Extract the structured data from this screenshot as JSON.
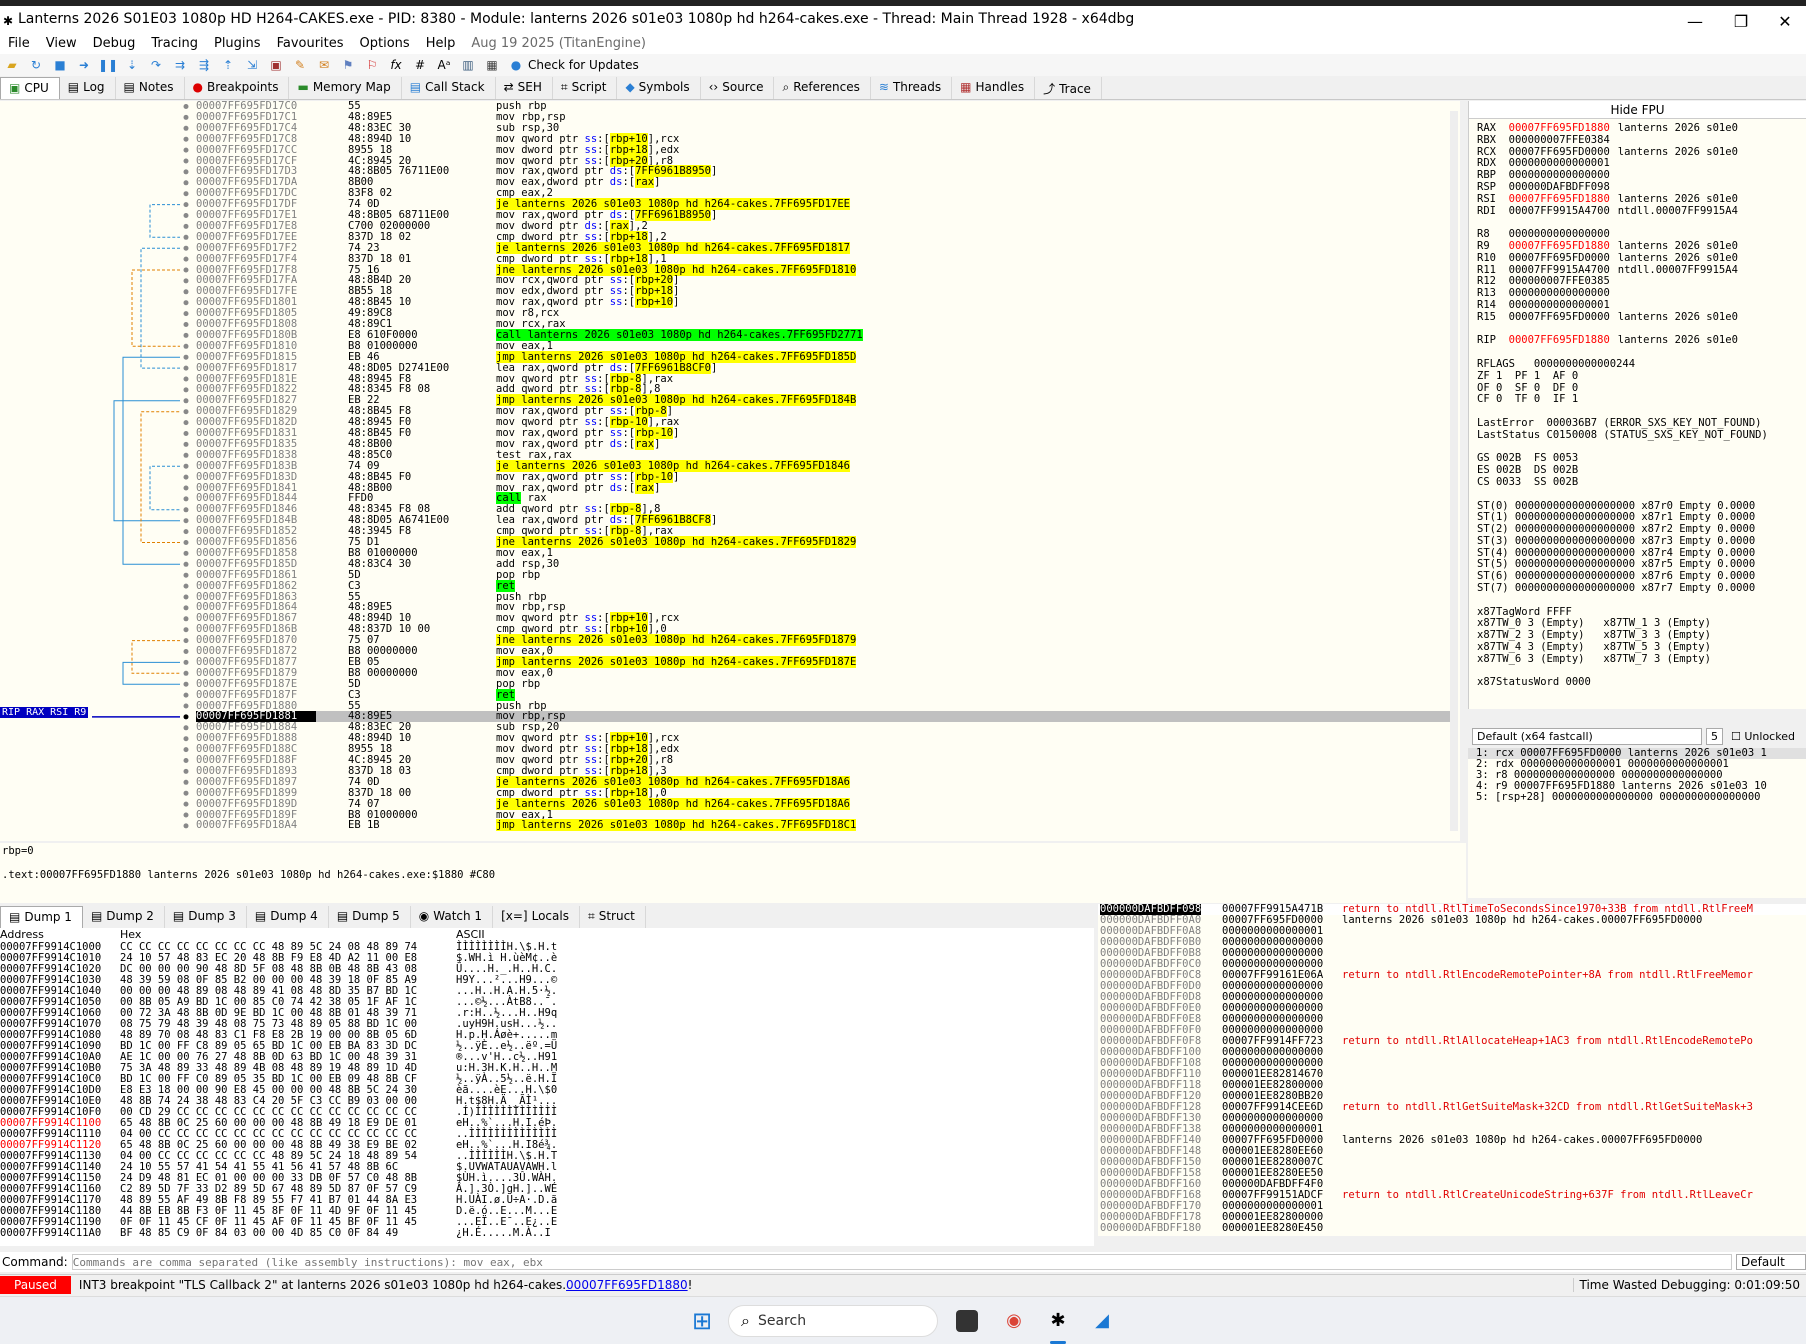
{
  "title": "Lanterns 2026 S01E03 1080p HD H264-CAKES.exe - PID: 8380 - Module: lanterns 2026 s01e03 1080p hd h264-cakes.exe - Thread: Main Thread 1928 - x64dbg",
  "menu": {
    "file": "File",
    "view": "View",
    "debug": "Debug",
    "tracing": "Tracing",
    "plugins": "Plugins",
    "favourites": "Favourites",
    "options": "Options",
    "help": "Help",
    "date": "Aug 19 2025 (TitanEngine)"
  },
  "toolbar": {
    "updates": "Check for Updates"
  },
  "tabs": [
    "CPU",
    "Log",
    "Notes",
    "Breakpoints",
    "Memory Map",
    "Call Stack",
    "SEH",
    "Script",
    "Symbols",
    "Source",
    "References",
    "Threads",
    "Handles",
    "Trace"
  ],
  "gutter_label": "RIP RAX RSI R9",
  "disasm": [
    [
      "00007FF695FD17C0",
      "55",
      "push rbp"
    ],
    [
      "00007FF695FD17C1",
      "48:89E5",
      "mov rbp,rsp"
    ],
    [
      "00007FF695FD17C4",
      "48:83EC 30",
      "sub rsp,30"
    ],
    [
      "00007FF695FD17C8",
      "48:894D 10",
      "mov qword ptr ss:[rbp+10],rcx"
    ],
    [
      "00007FF695FD17CC",
      "8955 18",
      "mov dword ptr ss:[rbp+18],edx"
    ],
    [
      "00007FF695FD17CF",
      "4C:8945 20",
      "mov qword ptr ss:[rbp+20],r8"
    ],
    [
      "00007FF695FD17D3",
      "48:8B05 76711E00",
      "mov rax,qword ptr ds:[7FF6961B8950]"
    ],
    [
      "00007FF695FD17DA",
      "8B00",
      "mov eax,dword ptr ds:[rax]"
    ],
    [
      "00007FF695FD17DC",
      "83F8 02",
      "cmp eax,2"
    ],
    [
      "00007FF695FD17DF",
      "74 0D",
      "je lanterns 2026 s01e03 1080p hd h264-cakes.7FF695FD17EE"
    ],
    [
      "00007FF695FD17E1",
      "48:8B05 68711E00",
      "mov rax,qword ptr ds:[7FF6961B8950]"
    ],
    [
      "00007FF695FD17E8",
      "C700 02000000",
      "mov dword ptr ds:[rax],2"
    ],
    [
      "00007FF695FD17EE",
      "837D 18 02",
      "cmp dword ptr ss:[rbp+18],2"
    ],
    [
      "00007FF695FD17F2",
      "74 23",
      "je lanterns 2026 s01e03 1080p hd h264-cakes.7FF695FD1817"
    ],
    [
      "00007FF695FD17F4",
      "837D 18 01",
      "cmp dword ptr ss:[rbp+18],1"
    ],
    [
      "00007FF695FD17F8",
      "75 16",
      "jne lanterns 2026 s01e03 1080p hd h264-cakes.7FF695FD1810"
    ],
    [
      "00007FF695FD17FA",
      "48:8B4D 20",
      "mov rcx,qword ptr ss:[rbp+20]"
    ],
    [
      "00007FF695FD17FE",
      "8B55 18",
      "mov edx,dword ptr ss:[rbp+18]"
    ],
    [
      "00007FF695FD1801",
      "48:8B45 10",
      "mov rax,qword ptr ss:[rbp+10]"
    ],
    [
      "00007FF695FD1805",
      "49:89C8",
      "mov r8,rcx"
    ],
    [
      "00007FF695FD1808",
      "48:89C1",
      "mov rcx,rax"
    ],
    [
      "00007FF695FD180B",
      "E8 610F0000",
      "call lanterns 2026 s01e03 1080p hd h264-cakes.7FF695FD2771"
    ],
    [
      "00007FF695FD1810",
      "B8 01000000",
      "mov eax,1"
    ],
    [
      "00007FF695FD1815",
      "EB 46",
      "jmp lanterns 2026 s01e03 1080p hd h264-cakes.7FF695FD185D"
    ],
    [
      "00007FF695FD1817",
      "48:8D05 D2741E00",
      "lea rax,qword ptr ds:[7FF6961B8CF0]"
    ],
    [
      "00007FF695FD181E",
      "48:8945 F8",
      "mov qword ptr ss:[rbp-8],rax"
    ],
    [
      "00007FF695FD1822",
      "48:8345 F8 08",
      "add qword ptr ss:[rbp-8],8"
    ],
    [
      "00007FF695FD1827",
      "EB 22",
      "jmp lanterns 2026 s01e03 1080p hd h264-cakes.7FF695FD184B"
    ],
    [
      "00007FF695FD1829",
      "48:8B45 F8",
      "mov rax,qword ptr ss:[rbp-8]"
    ],
    [
      "00007FF695FD182D",
      "48:8945 F0",
      "mov qword ptr ss:[rbp-10],rax"
    ],
    [
      "00007FF695FD1831",
      "48:8B45 F0",
      "mov rax,qword ptr ss:[rbp-10]"
    ],
    [
      "00007FF695FD1835",
      "48:8B00",
      "mov rax,qword ptr ds:[rax]"
    ],
    [
      "00007FF695FD1838",
      "48:85C0",
      "test rax,rax"
    ],
    [
      "00007FF695FD183B",
      "74 09",
      "je lanterns 2026 s01e03 1080p hd h264-cakes.7FF695FD1846"
    ],
    [
      "00007FF695FD183D",
      "48:8B45 F0",
      "mov rax,qword ptr ss:[rbp-10]"
    ],
    [
      "00007FF695FD1841",
      "48:8B00",
      "mov rax,qword ptr ds:[rax]"
    ],
    [
      "00007FF695FD1844",
      "FFD0",
      "call rax"
    ],
    [
      "00007FF695FD1846",
      "48:8345 F8 08",
      "add qword ptr ss:[rbp-8],8"
    ],
    [
      "00007FF695FD184B",
      "48:8D05 A6741E00",
      "lea rax,qword ptr ds:[7FF6961B8CF8]"
    ],
    [
      "00007FF695FD1852",
      "48:3945 F8",
      "cmp qword ptr ss:[rbp-8],rax"
    ],
    [
      "00007FF695FD1856",
      "75 D1",
      "jne lanterns 2026 s01e03 1080p hd h264-cakes.7FF695FD1829"
    ],
    [
      "00007FF695FD1858",
      "B8 01000000",
      "mov eax,1"
    ],
    [
      "00007FF695FD185D",
      "48:83C4 30",
      "add rsp,30"
    ],
    [
      "00007FF695FD1861",
      "5D",
      "pop rbp"
    ],
    [
      "00007FF695FD1862",
      "C3",
      "ret"
    ],
    [
      "00007FF695FD1863",
      "55",
      "push rbp"
    ],
    [
      "00007FF695FD1864",
      "48:89E5",
      "mov rbp,rsp"
    ],
    [
      "00007FF695FD1867",
      "48:894D 10",
      "mov qword ptr ss:[rbp+10],rcx"
    ],
    [
      "00007FF695FD186B",
      "48:837D 10 00",
      "cmp qword ptr ss:[rbp+10],0"
    ],
    [
      "00007FF695FD1870",
      "75 07",
      "jne lanterns 2026 s01e03 1080p hd h264-cakes.7FF695FD1879"
    ],
    [
      "00007FF695FD1872",
      "B8 00000000",
      "mov eax,0"
    ],
    [
      "00007FF695FD1877",
      "EB 05",
      "jmp lanterns 2026 s01e03 1080p hd h264-cakes.7FF695FD187E"
    ],
    [
      "00007FF695FD1879",
      "B8 00000000",
      "mov eax,0"
    ],
    [
      "00007FF695FD187E",
      "5D",
      "pop rbp"
    ],
    [
      "00007FF695FD187F",
      "C3",
      "ret"
    ],
    [
      "00007FF695FD1880",
      "55",
      "push rbp"
    ],
    [
      "00007FF695FD1881",
      "48:89E5",
      "mov rbp,rsp"
    ],
    [
      "00007FF695FD1884",
      "48:83EC 20",
      "sub rsp,20"
    ],
    [
      "00007FF695FD1888",
      "48:894D 10",
      "mov qword ptr ss:[rbp+10],rcx"
    ],
    [
      "00007FF695FD188C",
      "8955 18",
      "mov dword ptr ss:[rbp+18],edx"
    ],
    [
      "00007FF695FD188F",
      "4C:8945 20",
      "mov qword ptr ss:[rbp+20],r8"
    ],
    [
      "00007FF695FD1893",
      "837D 18 03",
      "cmp dword ptr ss:[rbp+18],3"
    ],
    [
      "00007FF695FD1897",
      "74 0D",
      "je lanterns 2026 s01e03 1080p hd h264-cakes.7FF695FD18A6"
    ],
    [
      "00007FF695FD1899",
      "837D 18 00",
      "cmp dword ptr ss:[rbp+18],0"
    ],
    [
      "00007FF695FD189D",
      "74 07",
      "je lanterns 2026 s01e03 1080p hd h264-cakes.7FF695FD18A6"
    ],
    [
      "00007FF695FD189F",
      "B8 01000000",
      "mov eax,1"
    ],
    [
      "00007FF695FD18A4",
      "EB 1B",
      "jmp lanterns 2026 s01e03 1080p hd h264-cakes.7FF695FD18C1"
    ]
  ],
  "current_row": 56,
  "info": {
    "line1": "rbp=0",
    "line2": ".text:00007FF695FD1880 lanterns 2026 s01e03 1080p hd h264-cakes.exe:$1880 #C80"
  },
  "registers": {
    "hide_fpu": "Hide FPU",
    "lines": [
      [
        "RAX",
        "00007FF695FD1880",
        "lanterns 2026 s01e0",
        true
      ],
      [
        "RBX",
        "000000007FFE0384",
        "",
        false
      ],
      [
        "RCX",
        "00007FF695FD0000",
        "lanterns 2026 s01e0",
        false
      ],
      [
        "RDX",
        "0000000000000001",
        "",
        false
      ],
      [
        "RBP",
        "0000000000000000",
        "",
        false
      ],
      [
        "RSP",
        "000000DAFBDFF098",
        "",
        false
      ],
      [
        "RSI",
        "00007FF695FD1880",
        "lanterns 2026 s01e0",
        true
      ],
      [
        "RDI",
        "00007FF9915A4700",
        "ntdll.00007FF9915A4",
        false
      ],
      [
        "",
        "",
        "",
        false
      ],
      [
        "R8",
        "0000000000000000",
        "",
        false
      ],
      [
        "R9",
        "00007FF695FD1880",
        "lanterns 2026 s01e0",
        true
      ],
      [
        "R10",
        "00007FF695FD0000",
        "lanterns 2026 s01e0",
        false
      ],
      [
        "R11",
        "00007FF9915A4700",
        "ntdll.00007FF9915A4",
        false
      ],
      [
        "R12",
        "000000007FFE0385",
        "",
        false
      ],
      [
        "R13",
        "0000000000000000",
        "",
        false
      ],
      [
        "R14",
        "0000000000000001",
        "",
        false
      ],
      [
        "R15",
        "00007FF695FD0000",
        "lanterns 2026 s01e0",
        false
      ],
      [
        "",
        "",
        "",
        false
      ],
      [
        "RIP",
        "00007FF695FD1880",
        "lanterns 2026 s01e0",
        true
      ]
    ],
    "rflags": [
      "RFLAGS   0000000000000244",
      "ZF 1  PF 1  AF 0",
      "OF 0  SF 0  DF 0",
      "CF 0  TF 0  IF 1"
    ],
    "errors": [
      "LastError  000036B7 (ERROR_SXS_KEY_NOT_FOUND)",
      "LastStatus C0150008 (STATUS_SXS_KEY_NOT_FOUND)"
    ],
    "segs": [
      "GS 002B  FS 0053",
      "ES 002B  DS 002B",
      "CS 0033  SS 002B"
    ],
    "fpu": [
      "ST(0) 0000000000000000000 x87r0 Empty 0.0000",
      "ST(1) 0000000000000000000 x87r1 Empty 0.0000",
      "ST(2) 0000000000000000000 x87r2 Empty 0.0000",
      "ST(3) 0000000000000000000 x87r3 Empty 0.0000",
      "ST(4) 0000000000000000000 x87r4 Empty 0.0000",
      "ST(5) 0000000000000000000 x87r5 Empty 0.0000",
      "ST(6) 0000000000000000000 x87r6 Empty 0.0000",
      "ST(7) 0000000000000000000 x87r7 Empty 0.0000"
    ],
    "tag": [
      "x87TagWord FFFF",
      "x87TW_0 3 (Empty)   x87TW_1 3 (Empty)",
      "x87TW_2 3 (Empty)   x87TW_3 3 (Empty)",
      "x87TW_4 3 (Empty)   x87TW_5 3 (Empty)",
      "x87TW_6 3 (Empty)   x87TW_7 3 (Empty)"
    ],
    "status_word": "x87StatusWord 0000"
  },
  "callconv": {
    "select": "Default (x64 fastcall)",
    "count": "5",
    "unlocked": "Unlocked"
  },
  "args": [
    "1: rcx 00007FF695FD0000 lanterns 2026 s01e03 1",
    "2: rdx 0000000000000001 0000000000000001",
    "3: r8 0000000000000000 0000000000000000",
    "4: r9 00007FF695FD1880 lanterns 2026 s01e03 10",
    "5: [rsp+28] 0000000000000000 0000000000000000"
  ],
  "dump_tabs": [
    "Dump 1",
    "Dump 2",
    "Dump 3",
    "Dump 4",
    "Dump 5",
    "Watch 1",
    "Locals",
    "Struct"
  ],
  "dump_headers": {
    "address": "Address",
    "hex": "Hex",
    "ascii": "ASCII"
  },
  "dump": [
    [
      "00007FF9914C1000",
      "CC CC CC CC CC CC CC CC 48 89 5C 24 08 48 89 74",
      "ÌÌÌÌÌÌÌÌH.\\$.H.t"
    ],
    [
      "00007FF9914C1010",
      "24 10 57 48 83 EC 20 48 8B F9 E8 4D A2 11 00 E8",
      "$.WH.ì H.ùèM¢..è"
    ],
    [
      "00007FF9914C1020",
      "DC 00 00 00 90 48 8D 5F 08 48 8B 0B 48 8B 43 08",
      "Ü....H._.H..H.C."
    ],
    [
      "00007FF9914C1030",
      "48 39 59 08 0F 85 B2 00 00 00 48 39 18 0F 85 A9",
      "H9Y...²...H9...©"
    ],
    [
      "00007FF9914C1040",
      "00 00 00 48 89 08 48 89 41 08 48 8D 35 B7 BD 1C",
      "...H..H.A.H.5·½."
    ],
    [
      "00007FF9914C1050",
      "00 8B 05 A9 BD 1C 00 85 C0 74 42 38 05 1F AF 1C",
      "...©½...ÀtB8..¯."
    ],
    [
      "00007FF9914C1060",
      "00 72 3A 48 8B 0D 9E BD 1C 00 48 8B 01 48 39 71",
      ".r:H..½...H..H9q"
    ],
    [
      "00007FF9914C1070",
      "08 75 79 48 39 48 08 75 73 48 89 05 88 BD 1C 00",
      ".uyH9H.usH...½.."
    ],
    [
      "00007FF9914C1080",
      "48 89 70 08 48 83 C1 F8 E8 2B 19 00 00 8B 05 6D",
      "H.p.H.Áøè+.....m"
    ],
    [
      "00007FF9914C1090",
      "BD 1C 00 FF C8 89 05 65 BD 1C 00 EB BA 83 3D DC",
      "½..ÿÈ..e½..ëº.=Ü"
    ],
    [
      "00007FF9914C10A0",
      "AE 1C 00 00 76 27 48 8B 0D 63 BD 1C 00 48 39 31",
      "®...v'H..c½..H91"
    ],
    [
      "00007FF9914C10B0",
      "75 3A 48 89 33 48 89 4B 08 48 89 19 48 89 1D 4D",
      "u:H.3H.K.H..H..M"
    ],
    [
      "00007FF9914C10C0",
      "BD 1C 00 FF C0 89 05 35 BD 1C 00 EB 09 48 8B CF",
      "½..ÿÀ..5½..ë.H.Ï"
    ],
    [
      "00007FF9914C10D0",
      "E8 E3 18 00 00 90 E8 45 00 00 00 48 8B 5C 24 30",
      "èã....èE...H.\\$0"
    ],
    [
      "00007FF9914C10E0",
      "48 8B 74 24 38 48 83 C4 20 5F C3 CC B9 03 00 00",
      "H.t$8H.Ä _ÃÌ¹..."
    ],
    [
      "00007FF9914C10F0",
      "00 CD 29 CC CC CC CC CC CC CC CC CC CC CC CC CC",
      ".Í)ÌÌÌÌÌÌÌÌÌÌÌÌÌ"
    ],
    [
      "00007FF9914C1100",
      "65 48 8B 0C 25 60 00 00 00 48 8B 49 18 E9 DE 01",
      "eH..%`...H.I.éÞ."
    ],
    [
      "00007FF9914C1110",
      "04 00 CC CC CC CC CC CC CC CC CC CC CC CC CC CC",
      "..ÌÌÌÌÌÌÌÌÌÌÌÌÌÌ"
    ],
    [
      "00007FF9914C1120",
      "65 48 8B 0C 25 60 00 00 00 48 8B 49 38 E9 BE 02",
      "eH..%`...H.I8é¾."
    ],
    [
      "00007FF9914C1130",
      "04 00 CC CC CC CC CC CC 48 89 5C 24 18 48 89 54",
      "..ÌÌÌÌÌÌH.\\$.H.T"
    ],
    [
      "00007FF9914C1140",
      "24 10 55 57 41 54 41 55 41 56 41 57 48 8B 6C",
      "$.UVWATAUAVAWH.l"
    ],
    [
      "00007FF9914C1150",
      "24 D9 48 81 EC 01 00 00 00 33 DB 0F 57 C0 48 8B",
      "$ÙH.ì....3Û.WÀH."
    ],
    [
      "00007FF9914C1160",
      "C2 89 5D 7F 33 D2 89 5D 67 48 89 5D 87 0F 57 C9",
      "Â.].3Ò.]gH.]..WÉ"
    ],
    [
      "00007FF9914C1170",
      "48 89 55 AF 49 8B F8 89 55 F7 41 B7 01 44 8A E3",
      "H.UÀI.ø.U÷A·.D.ã"
    ],
    [
      "00007FF9914C1180",
      "44 8B EB 8B F3 0F 11 45 8F 0F 11 4D 9F 0F 11 45",
      "D.ë.ó..E...M...E"
    ],
    [
      "00007FF9914C1190",
      "0F 0F 11 45 CF 0F 11 45 AF 0F 11 45 BF 0F 11 45",
      "...EÏ..E¯..E¿..E"
    ],
    [
      "00007FF9914C11A0",
      "BF 48 85 C9 0F 84 03 00 00 4D 85 C0 0F 84 49",
      "¿H.É.....M.À..I"
    ]
  ],
  "dump_red_rows": [
    16,
    18
  ],
  "stack": [
    [
      "000000DAFBDFF098",
      "00007FF9915A471B",
      "return to ntdll.RtlTimeToSecondsSince1970+33B from ntdll.RtlFreeM",
      "red"
    ],
    [
      "000000DAFBDFF0A0",
      "00007FF695FD0000",
      "lanterns 2026 s01e03 1080p hd h264-cakes.00007FF695FD0000",
      "black"
    ],
    [
      "000000DAFBDFF0A8",
      "0000000000000001",
      "",
      ""
    ],
    [
      "000000DAFBDFF0B0",
      "0000000000000000",
      "",
      ""
    ],
    [
      "000000DAFBDFF0B8",
      "0000000000000000",
      "",
      ""
    ],
    [
      "000000DAFBDFF0C0",
      "0000000000000000",
      "",
      ""
    ],
    [
      "000000DAFBDFF0C8",
      "00007FF99161E06A",
      "return to ntdll.RtlEncodeRemotePointer+8A from ntdll.RtlFreeMemor",
      "red"
    ],
    [
      "000000DAFBDFF0D0",
      "0000000000000000",
      "",
      ""
    ],
    [
      "000000DAFBDFF0D8",
      "0000000000000000",
      "",
      ""
    ],
    [
      "000000DAFBDFF0E0",
      "0000000000000000",
      "",
      ""
    ],
    [
      "000000DAFBDFF0E8",
      "0000000000000000",
      "",
      ""
    ],
    [
      "000000DAFBDFF0F0",
      "0000000000000000",
      "",
      ""
    ],
    [
      "000000DAFBDFF0F8",
      "00007FF9914FF723",
      "return to ntdll.RtlAllocateHeap+1AC3 from ntdll.RtlEncodeRemotePo",
      "red"
    ],
    [
      "000000DAFBDFF100",
      "0000000000000000",
      "",
      ""
    ],
    [
      "000000DAFBDFF108",
      "0000000000000000",
      "",
      ""
    ],
    [
      "000000DAFBDFF110",
      "000001EE82814670",
      "",
      ""
    ],
    [
      "000000DAFBDFF118",
      "000001EE82800000",
      "",
      ""
    ],
    [
      "000000DAFBDFF120",
      "000001EE8280BB20",
      "",
      ""
    ],
    [
      "000000DAFBDFF128",
      "00007FF9914CEE6D",
      "return to ntdll.RtlGetSuiteMask+32CD from ntdll.RtlGetSuiteMask+3",
      "red"
    ],
    [
      "000000DAFBDFF130",
      "0000000000000000",
      "",
      ""
    ],
    [
      "000000DAFBDFF138",
      "0000000000000001",
      "",
      ""
    ],
    [
      "000000DAFBDFF140",
      "00007FF695FD0000",
      "lanterns 2026 s01e03 1080p hd h264-cakes.00007FF695FD0000",
      "black"
    ],
    [
      "000000DAFBDFF148",
      "000001EE8280EE60",
      "",
      ""
    ],
    [
      "000000DAFBDFF150",
      "000001EE8280007C",
      "",
      ""
    ],
    [
      "000000DAFBDFF158",
      "000001EE8280EE50",
      "",
      ""
    ],
    [
      "000000DAFBDFF160",
      "000000DAFBDFF4F0",
      "",
      ""
    ],
    [
      "000000DAFBDFF168",
      "00007FF99151ADCF",
      "return to ntdll.RtlCreateUnicodeString+637F from ntdll.RtlLeaveCr",
      "red"
    ],
    [
      "000000DAFBDFF170",
      "0000000000000001",
      "",
      ""
    ],
    [
      "000000DAFBDFF178",
      "000001EE82800000",
      "",
      ""
    ],
    [
      "000000DAFBDFF180",
      "000001EE8280E450",
      "",
      ""
    ]
  ],
  "cmd": {
    "label": "Command:",
    "placeholder": "Commands are comma separated (like assembly instructions): mov eax, ebx",
    "mode": "Default"
  },
  "status": {
    "state": "Paused",
    "msg": "INT3 breakpoint \"TLS Callback 2\" at lanterns 2026 s01e03 1080p hd h264-cakes.",
    "link": "00007FF695FD1880",
    "link_suffix": "!",
    "time": "Time Wasted Debugging: 0:01:09:50"
  },
  "taskbar": {
    "search": "Search"
  }
}
